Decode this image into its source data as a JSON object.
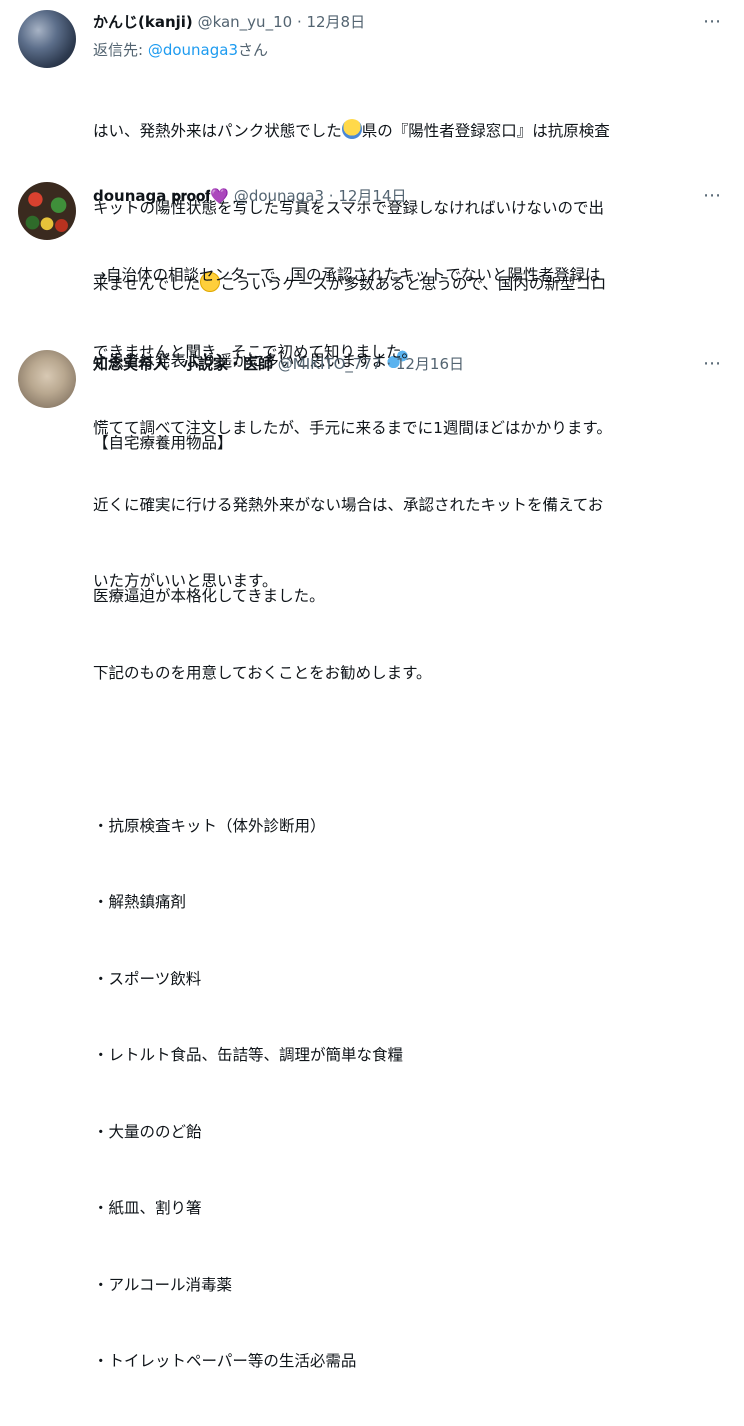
{
  "more_icon": "⋯",
  "tweets": [
    {
      "name": "かんじ(kanji)",
      "handle": "@kan_yu_10",
      "date": "· 12月8日",
      "reply_prefix": "返信先: ",
      "reply_handle": "@dounaga3",
      "reply_suffix": "さん",
      "lines": [
        "はい、発熱外来はパンク状態でした",
        "県の『陽性者登録窓口』は抗原検査",
        "キットの陽性状態を写した写真をスマホで登録しなければいけないので出",
        "来ませんでした",
        "こういうケースが多数あると思うので、国内の新型コロ",
        "ナ患者は発表より遥かに多いと思いますよ"
      ]
    },
    {
      "name": "dounaga 𝐩𝐫𝐨𝐨𝐟",
      "heart": "💜",
      "handle": "@dounaga3",
      "date": "· 12月14日",
      "lines": [
        "→自治体の相談センターで、国の承認されたキットでないと陽性者登録は",
        "できませんと聞き、そこで初めて知りました。",
        "慌てて調べて注文しましたが、手元に来るまでに1週間ほどはかかります。",
        "近くに確実に行ける発熱外来がない場合は、承認されたキットを備えてお",
        "いた方がいいと思います。"
      ]
    },
    {
      "name": "知念実希人　小説家・医師",
      "handle": "@MIKITO_777",
      "date": "· 12月16日",
      "lines": [
        "【自宅療養用物品】",
        "",
        "医療逼迫が本格化してきました。",
        "下記のものを用意しておくことをお勧めします。",
        "",
        "・抗原検査キット（体外診断用）",
        "・解熱鎮痛剤",
        "・スポーツ飲料",
        "・レトルト食品、缶詰等、調理が簡単な食糧",
        "・大量ののど飴",
        "・紙皿、割り箸",
        "・アルコール消毒薬",
        "・トイレットペーパー等の生活必需品"
      ]
    }
  ]
}
